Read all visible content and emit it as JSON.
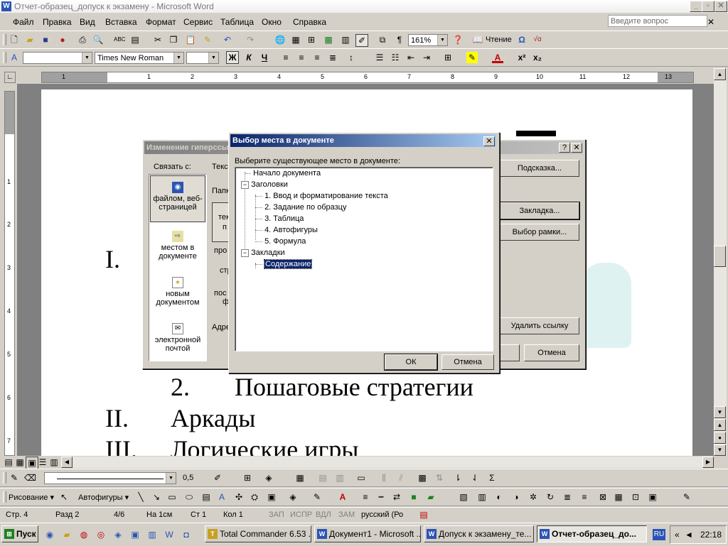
{
  "window": {
    "title": "Отчет-образец_допуск к экзамену - Microsoft Word",
    "app_icon": "W",
    "close_glyph": "✕"
  },
  "menu": {
    "items": [
      "Файл",
      "Правка",
      "Вид",
      "Вставка",
      "Формат",
      "Сервис",
      "Таблица",
      "Окно",
      "Справка"
    ],
    "help_placeholder": "Введите вопрос",
    "doc_close": "✕"
  },
  "standard_toolbar": {
    "zoom": "161%",
    "reading_label": "Чтение",
    "pilcrow": "¶"
  },
  "formatting_toolbar": {
    "style": "",
    "font": "Times New Roman",
    "size": "",
    "bold": "Ж",
    "italic": "К",
    "underline": "Ч",
    "superscript": "x²",
    "subscript": "x₂"
  },
  "ruler": {
    "numbers": [
      "1",
      "1",
      "2",
      "3",
      "4",
      "5",
      "6",
      "7",
      "8",
      "9",
      "10",
      "11",
      "12",
      "13"
    ],
    "vnumbers": [
      "1",
      "2",
      "3",
      "4",
      "5",
      "6",
      "7"
    ]
  },
  "document": {
    "lines": [
      {
        "num": "I.",
        "text": ""
      },
      {
        "num": "2.",
        "text": "Пошаговые стратегии"
      },
      {
        "num": "II.",
        "text": "Аркады"
      },
      {
        "num": "III.",
        "text": "Логические игры"
      }
    ]
  },
  "hyperlink_dialog": {
    "title": "Изменение гиперссылки",
    "link_with": "Связать с:",
    "sidebar": [
      {
        "label": "файлом, веб-страницей",
        "icon": "web-page-icon"
      },
      {
        "label": "местом в документе",
        "icon": "document-place-icon"
      },
      {
        "label": "новым документом",
        "icon": "new-document-icon"
      },
      {
        "label": "электронной почтой",
        "icon": "email-icon"
      }
    ],
    "text_label": "Текс",
    "folder_label": "Папк",
    "fragments": [
      "тек",
      "п",
      "про",
      "стр",
      "пос",
      "ф"
    ],
    "address_label": "Адре",
    "buttons": {
      "tooltip": "Подсказка...",
      "bookmark": "Закладка...",
      "frame": "Выбор рамки...",
      "remove_link": "Удалить ссылку",
      "cancel": "Отмена"
    },
    "help_glyph": "?",
    "close_glyph": "✕"
  },
  "place_dialog": {
    "title": "Выбор места в документе",
    "prompt": "Выберите существующее место в документе:",
    "tree": [
      {
        "text": "Начало документа",
        "level": 0,
        "toggle": ""
      },
      {
        "text": "Заголовки",
        "level": 0,
        "toggle": "−"
      },
      {
        "text": "1. Ввод и форматирование текста",
        "level": 1,
        "toggle": ""
      },
      {
        "text": "2. Задание по образцу",
        "level": 1,
        "toggle": ""
      },
      {
        "text": "3. Таблица",
        "level": 1,
        "toggle": ""
      },
      {
        "text": "4. Автофигуры",
        "level": 1,
        "toggle": ""
      },
      {
        "text": "5. Формула",
        "level": 1,
        "toggle": ""
      },
      {
        "text": "Закладки",
        "level": 0,
        "toggle": "−"
      },
      {
        "text": "Содержание",
        "level": 1,
        "toggle": "",
        "selected": true
      }
    ],
    "ok": "ОК",
    "cancel": "Отмена",
    "close_glyph": "✕"
  },
  "drawing_toolbar": {
    "line_width": "0,5",
    "draw_label": "Рисование",
    "autoshapes_label": "Автофигуры",
    "sum": "Σ"
  },
  "status": {
    "page": "Стр. 4",
    "section": "Разд 2",
    "pages": "4/6",
    "at": "На 1см",
    "line": "Ст 1",
    "col": "Кол 1",
    "rec": "ЗАП",
    "trk": "ИСПР",
    "ext": "ВДЛ",
    "ovr": "ЗАМ",
    "lang": "русский (Ро"
  },
  "taskbar": {
    "start": "Пуск",
    "tasks": [
      {
        "label": "Total Commander 6.53 ...",
        "active": false
      },
      {
        "label": "Документ1 - Microsoft ...",
        "active": false
      },
      {
        "label": "Допуск к экзамену_те...",
        "active": false
      },
      {
        "label": "Отчет-образец_до...",
        "active": true
      }
    ],
    "lang": "RU",
    "time": "22:18"
  },
  "colors": {
    "title_active": "#0a246a",
    "title_active_end": "#a6caf0",
    "title_inactive": "#808080",
    "title_inactive_end": "#c0c0c0",
    "selection": "#0a246a",
    "word_blue": "#2a54b4"
  }
}
